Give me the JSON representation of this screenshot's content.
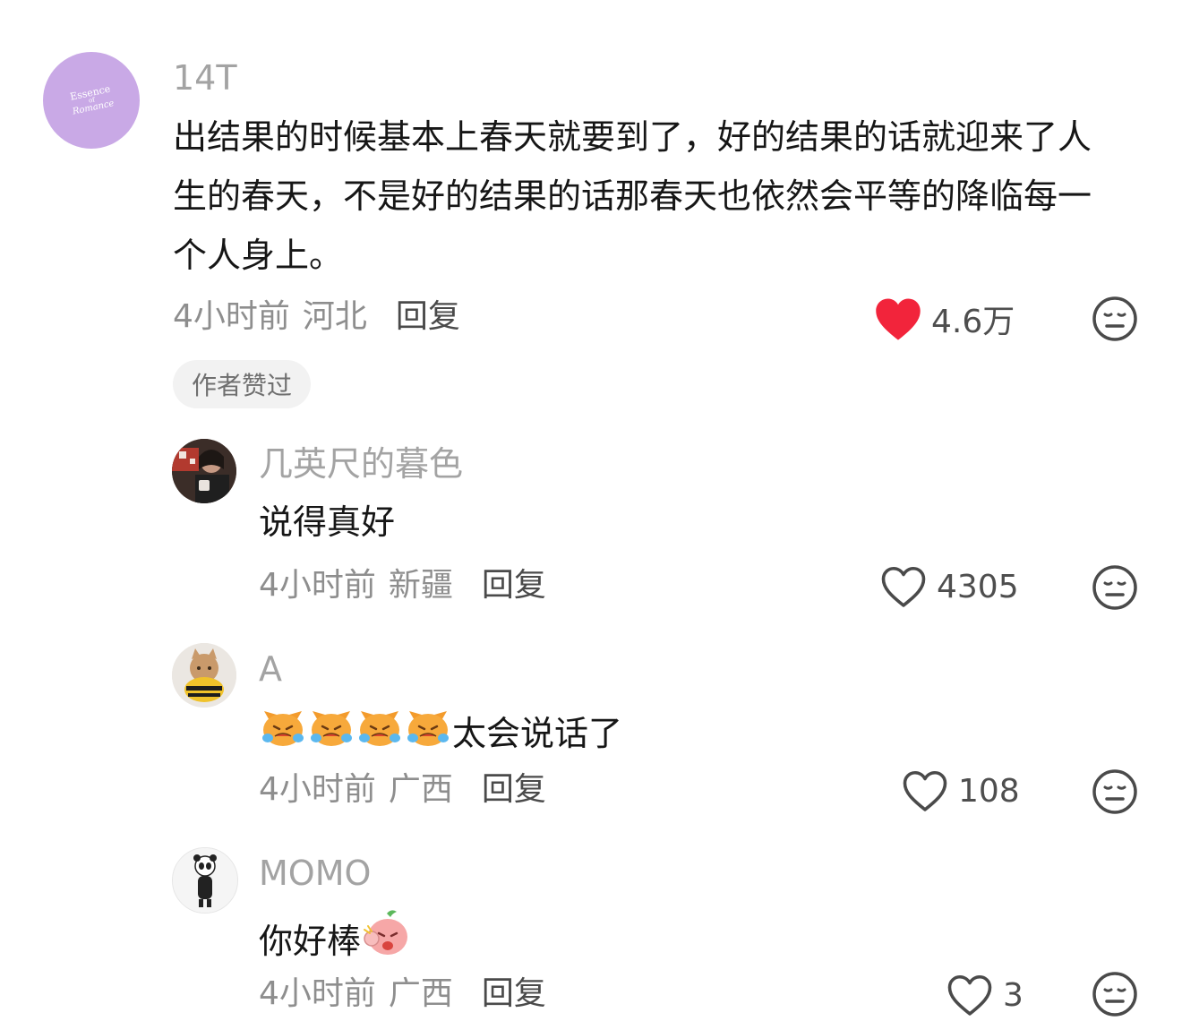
{
  "comments": [
    {
      "username": "14T",
      "avatar_text": [
        "Essence",
        "of",
        "Romance"
      ],
      "avatar_color": "#c9a9e6",
      "text": "出结果的时候基本上春天就要到了，好的结果的话就迎来了人生的春天，不是好的结果的话那春天也依然会平等的降临每一个人身上。",
      "time": "4小时前",
      "location": "河北",
      "reply_label": "回复",
      "likes": "4.6万",
      "liked": true,
      "badge": "作者赞过"
    },
    {
      "username": "几英尺的暮色",
      "text": "说得真好",
      "time": "4小时前",
      "location": "新疆",
      "reply_label": "回复",
      "likes": "4305",
      "liked": false
    },
    {
      "username": "A",
      "text": "太会说话了",
      "emoji_names": [
        "crying-cat-emoji",
        "crying-cat-emoji",
        "crying-cat-emoji",
        "crying-cat-emoji"
      ],
      "time": "4小时前",
      "location": "广西",
      "reply_label": "回复",
      "likes": "108",
      "liked": false
    },
    {
      "username": "MOMO",
      "text": "你好棒",
      "emoji_names": [
        "peach-thumbs-up-emoji"
      ],
      "time": "4小时前",
      "location": "广西",
      "reply_label": "回复",
      "likes": "3",
      "liked": false
    }
  ],
  "colors": {
    "liked_heart": "#f2243b",
    "username": "#a3a3a3",
    "meta": "#8e8e8e"
  }
}
